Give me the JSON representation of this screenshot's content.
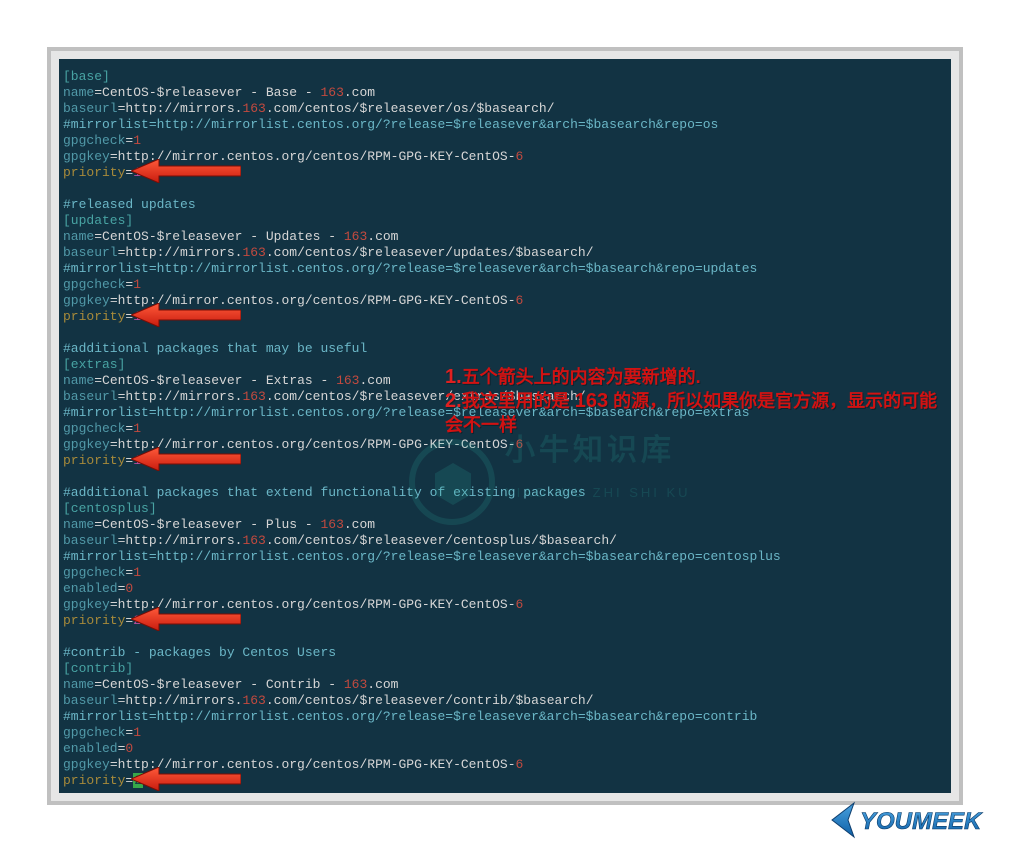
{
  "repos": [
    {
      "section": "[base]",
      "comment": null,
      "name_prefix": "CentOS-$releasever - Base - ",
      "name_num": "163",
      "name_suffix": ".com",
      "baseurl_prefix": "http://mirrors.",
      "baseurl_num": "163",
      "baseurl_suffix": ".com/centos/$releasever/os/$basearch/",
      "mirrorlist": "#mirrorlist=http://mirrorlist.centos.org/?release=$releasever&arch=$basearch&repo=os",
      "gpgcheck": "1",
      "enabled": null,
      "gpgkey_prefix": "http://mirror.centos.org/centos/RPM-GPG-KEY-CentOS-",
      "gpgkey_num": "6",
      "priority": "1",
      "priority_cursor": false
    },
    {
      "section": "[updates]",
      "comment": "#released updates",
      "name_prefix": "CentOS-$releasever - Updates - ",
      "name_num": "163",
      "name_suffix": ".com",
      "baseurl_prefix": "http://mirrors.",
      "baseurl_num": "163",
      "baseurl_suffix": ".com/centos/$releasever/updates/$basearch/",
      "mirrorlist": "#mirrorlist=http://mirrorlist.centos.org/?release=$releasever&arch=$basearch&repo=updates",
      "gpgcheck": "1",
      "enabled": null,
      "gpgkey_prefix": "http://mirror.centos.org/centos/RPM-GPG-KEY-CentOS-",
      "gpgkey_num": "6",
      "priority": "1",
      "priority_cursor": false
    },
    {
      "section": "[extras]",
      "comment": "#additional packages that may be useful",
      "name_prefix": "CentOS-$releasever - Extras - ",
      "name_num": "163",
      "name_suffix": ".com",
      "baseurl_prefix": "http://mirrors.",
      "baseurl_num": "163",
      "baseurl_suffix": ".com/centos/$releasever/extras/$basearch/",
      "mirrorlist": "#mirrorlist=http://mirrorlist.centos.org/?release=$releasever&arch=$basearch&repo=extras",
      "gpgcheck": "1",
      "enabled": null,
      "gpgkey_prefix": "http://mirror.centos.org/centos/RPM-GPG-KEY-CentOS-",
      "gpgkey_num": "6",
      "priority": "1",
      "priority_cursor": false
    },
    {
      "section": "[centosplus]",
      "comment": "#additional packages that extend functionality of existing packages",
      "name_prefix": "CentOS-$releasever - Plus - ",
      "name_num": "163",
      "name_suffix": ".com",
      "baseurl_prefix": "http://mirrors.",
      "baseurl_num": "163",
      "baseurl_suffix": ".com/centos/$releasever/centosplus/$basearch/",
      "mirrorlist": "#mirrorlist=http://mirrorlist.centos.org/?release=$releasever&arch=$basearch&repo=centosplus",
      "gpgcheck": "1",
      "enabled": "0",
      "gpgkey_prefix": "http://mirror.centos.org/centos/RPM-GPG-KEY-CentOS-",
      "gpgkey_num": "6",
      "priority": "2",
      "priority_cursor": false
    },
    {
      "section": "[contrib]",
      "comment": "#contrib - packages by Centos Users",
      "name_prefix": "CentOS-$releasever - Contrib - ",
      "name_num": "163",
      "name_suffix": ".com",
      "baseurl_prefix": "http://mirrors.",
      "baseurl_num": "163",
      "baseurl_suffix": ".com/centos/$releasever/contrib/$basearch/",
      "mirrorlist": "#mirrorlist=http://mirrorlist.centos.org/?release=$releasever&arch=$basearch&repo=contrib",
      "gpgcheck": "1",
      "enabled": "0",
      "gpgkey_prefix": "http://mirror.centos.org/centos/RPM-GPG-KEY-CentOS-",
      "gpgkey_num": "6",
      "priority": "2",
      "priority_cursor": true
    }
  ],
  "labels": {
    "name": "name",
    "baseurl": "baseurl",
    "gpgcheck": "gpgcheck",
    "enabled": "enabled",
    "gpgkey": "gpgkey",
    "priority": "priority",
    "eq": "="
  },
  "annotation": {
    "n1": "1.",
    "l1": "五个箭头上的内容为要新增的.",
    "n2": "2.",
    "l2a": "我这里用的是 ",
    "l2b": "163",
    "l2c": " 的源，所以如果你是官方源，显示的可能会不一样"
  },
  "arrow_y": [
    156,
    300,
    444,
    604,
    764
  ],
  "watermark": {
    "title": "小牛知识库",
    "sub": "XIAO NIU ZHI SHI KU"
  },
  "brand": "YOUMEEK"
}
